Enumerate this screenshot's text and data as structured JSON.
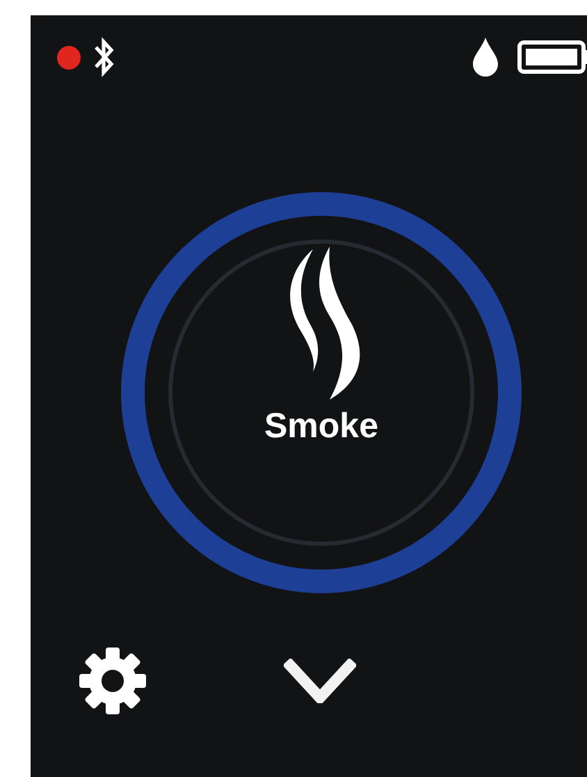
{
  "status_bar": {
    "recording": true
  },
  "mode": {
    "label": "Smoke",
    "active": true
  }
}
